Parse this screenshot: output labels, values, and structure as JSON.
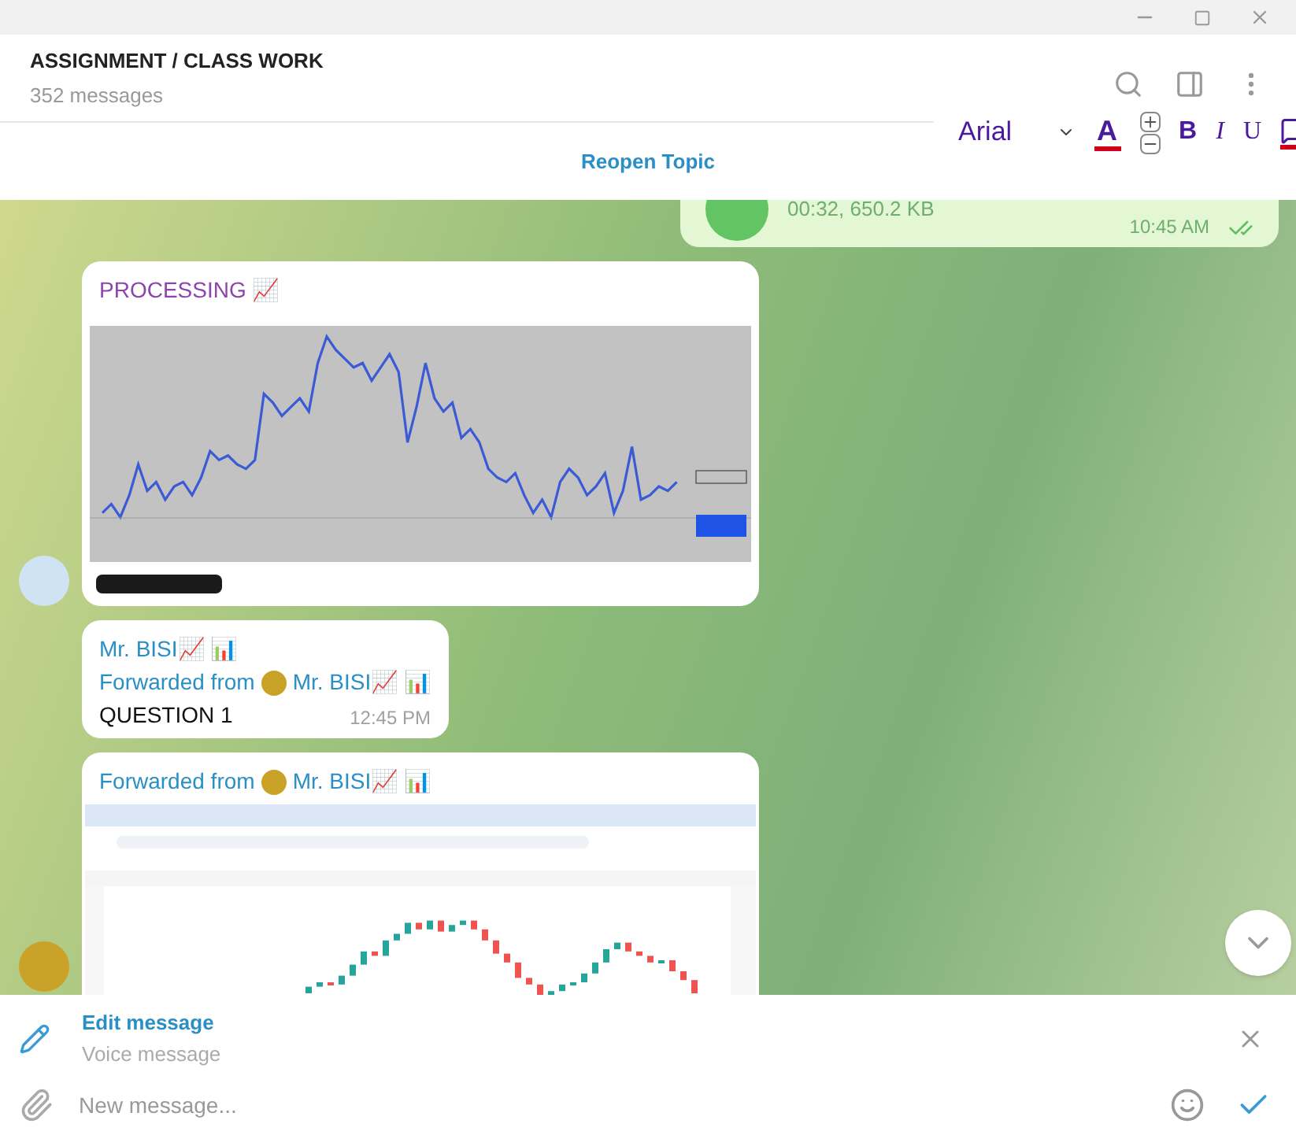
{
  "header": {
    "title": "ASSIGNMENT / CLASS WORK",
    "subtitle": "352 messages"
  },
  "topic_bar": {
    "button": "Reopen Topic"
  },
  "format_toolbar": {
    "font": "Arial",
    "font_color": "A",
    "bold": "B",
    "italic": "I",
    "underline": "U"
  },
  "messages": [
    {
      "kind": "voice",
      "outgoing": true,
      "info": "00:32, 650.2 KB",
      "time": "10:45 AM",
      "read": true,
      "avatar": false
    },
    {
      "kind": "image",
      "outgoing": false,
      "title": "PROCESSING 📈",
      "avatar": true
    },
    {
      "kind": "text",
      "outgoing": false,
      "sender": "Mr. BISI📈 📊",
      "forwarded_label": "Forwarded from",
      "forwarded_name": "Mr. BISI📈 📊",
      "text": "QUESTION 1",
      "time": "12:45 PM",
      "avatar": false
    },
    {
      "kind": "screenshot",
      "outgoing": false,
      "forwarded_label": "Forwarded from",
      "forwarded_name": "Mr. BISI📈 📊",
      "avatar": true
    }
  ],
  "composer": {
    "edit_title": "Edit message",
    "edit_subtitle": "Voice message",
    "placeholder": "New message..."
  }
}
